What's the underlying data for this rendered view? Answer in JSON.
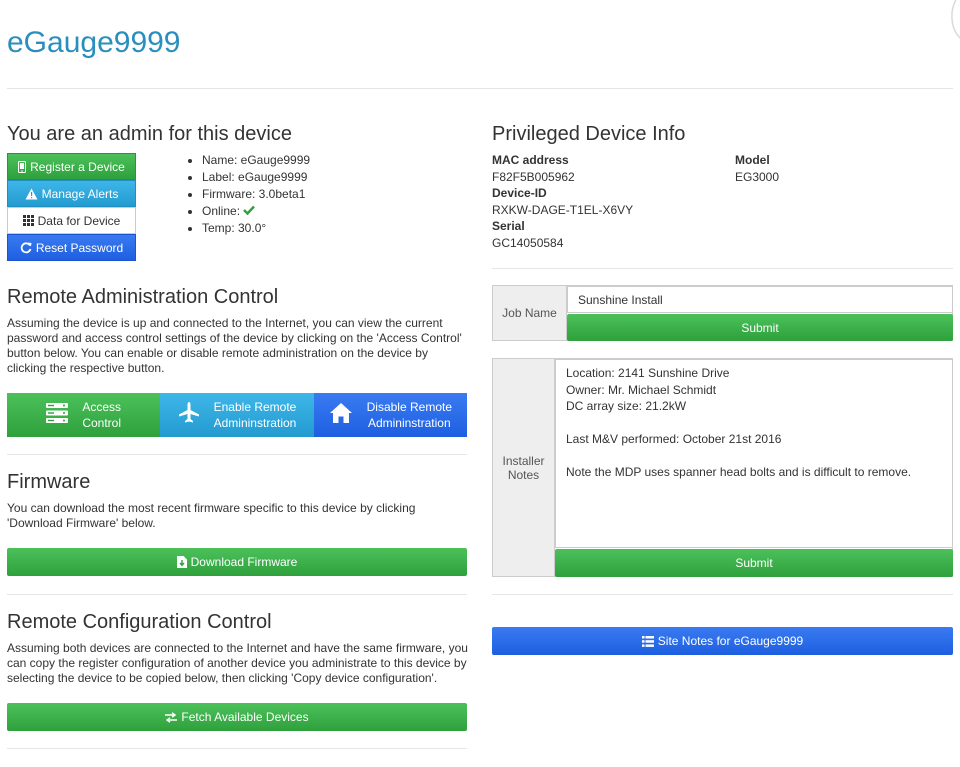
{
  "header": {
    "title": "eGauge9999"
  },
  "admin": {
    "heading": "You are an admin for this device",
    "buttons": [
      "Register a Device",
      "Manage Alerts",
      "Data for Device",
      "Reset Password"
    ],
    "info": {
      "name": "Name: eGauge9999",
      "label": "Label: eGauge9999",
      "firmware": "Firmware: 3.0beta1",
      "online": "Online:",
      "temp": "Temp: 30.0°"
    }
  },
  "remote_admin": {
    "heading": "Remote Administration Control",
    "description": "Assuming the device is up and connected to the Internet, you can view the current password and access control settings of the device by clicking on the 'Access Control' button below. You can enable or disable remote administration on the device by clicking the respective button.",
    "buttons": [
      {
        "line1": "Access",
        "line2": "Control"
      },
      {
        "line1": "Enable Remote",
        "line2": "Admininstration"
      },
      {
        "line1": "Disable Remote",
        "line2": "Admininstration"
      }
    ]
  },
  "firmware": {
    "heading": "Firmware",
    "description": "You can download the most recent firmware specific to this device by clicking 'Download Firmware' below.",
    "button": "Download Firmware"
  },
  "remote_config": {
    "heading": "Remote Configuration Control",
    "description": "Assuming both devices are connected to the Internet and have the same firmware, you can copy the register configuration of another device you administrate to this device by selecting the device to be copied below, then clicking 'Copy device configuration'.",
    "button": "Fetch Available Devices"
  },
  "privileged": {
    "heading": "Privileged Device Info",
    "mac_label": "MAC address",
    "mac_value": "F82F5B005962",
    "model_label": "Model",
    "model_value": "EG3000",
    "device_id_label": "Device-ID",
    "device_id_value": "RXKW-DAGE-T1EL-X6VY",
    "serial_label": "Serial",
    "serial_value": "GC14050584"
  },
  "job": {
    "label": "Job Name",
    "value": "Sunshine Install",
    "submit": "Submit"
  },
  "installer": {
    "label_line1": "Installer",
    "label_line2": "Notes",
    "value": "Location: 2141 Sunshine Drive\nOwner: Mr. Michael Schmidt\nDC array size: 21.2kW\n\nLast M&V performed: October 21st 2016\n\nNote the MDP uses spanner head bolts and is difficult to remove.",
    "submit": "Submit"
  },
  "site_notes": {
    "button": "Site Notes for eGauge9999"
  },
  "colors": {
    "title": "#2a8fbd",
    "green": "#2ea03c",
    "cyan": "#239bd0",
    "blue": "#1d5fe0"
  },
  "icons": [
    "mobile-icon",
    "warning-icon",
    "grid-icon",
    "refresh-icon",
    "server-icon",
    "plane-icon",
    "home-icon",
    "file-download-icon",
    "exchange-icon",
    "list-icon",
    "check-icon"
  ]
}
